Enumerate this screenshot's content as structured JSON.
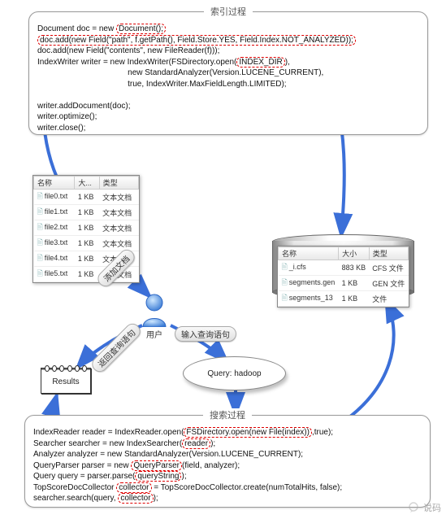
{
  "index_panel": {
    "title": "索引过程",
    "code_plain_1a": "Document doc = new ",
    "code_hl_1": "Document();",
    "code_plain_2a": "doc.add(new Field(\"path\", f.getPath(), Field.Store.YES, Field.Index.NOT_ANALYZED));",
    "code_plain_3": "doc.add(new Field(\"contents\", new FileReader(f)));",
    "code_plain_4a": "IndexWriter writer = new IndexWriter(FSDirectory.open(",
    "code_hl_4": "INDEX_DIR",
    "code_plain_4b": "),",
    "code_plain_5": "                                        new StandardAnalyzer(Version.LUCENE_CURRENT),",
    "code_plain_6": "                                        true, IndexWriter.MaxFieldLength.LIMITED);",
    "code_blank": "",
    "code_plain_7": "writer.addDocument(doc);",
    "code_plain_8": "writer.optimize();",
    "code_plain_9": "writer.close();"
  },
  "search_panel": {
    "title": "搜索过程",
    "l1a": "IndexReader reader = IndexReader.open(",
    "l1h": "FSDirectory.open(new File(index))",
    "l1b": ",true);",
    "l2a": "Searcher searcher = new IndexSearcher(",
    "l2h": "reader",
    "l2b": ");",
    "l3": "Analyzer analyzer = new StandardAnalyzer(Version.LUCENE_CURRENT);",
    "l4a": "QueryParser parser = new ",
    "l4h": "QueryParser",
    "l4b": "(field, analyzer);",
    "l5a": "Query query = parser.parse(",
    "l5h": "queryString",
    "l5b": ");",
    "l6a": "TopScoreDocCollector ",
    "l6h": "collector",
    "l6b": " = TopScoreDocCollector.create(numTotalHits, false);",
    "l7a": "searcher.search(query, ",
    "l7h": "collector",
    "l7b": ");"
  },
  "file_table": {
    "headers": [
      "名称",
      "大...",
      "类型"
    ],
    "rows": [
      [
        "file0.txt",
        "1 KB",
        "文本文档"
      ],
      [
        "file1.txt",
        "1 KB",
        "文本文档"
      ],
      [
        "file2.txt",
        "1 KB",
        "文本文档"
      ],
      [
        "file3.txt",
        "1 KB",
        "文本文档"
      ],
      [
        "file4.txt",
        "1 KB",
        "文本文档"
      ],
      [
        "file5.txt",
        "1 KB",
        "文本文档"
      ]
    ]
  },
  "index_dir_table": {
    "headers": [
      "名称",
      "大小",
      "类型"
    ],
    "rows": [
      [
        "_i.cfs",
        "883 KB",
        "CFS 文件"
      ],
      [
        "segments.gen",
        "1 KB",
        "GEN 文件"
      ],
      [
        "segments_13",
        "1 KB",
        "文件"
      ]
    ]
  },
  "user_label": "用户",
  "arrow_labels": {
    "add_doc": "添加文档",
    "return_query": "返回查询语句",
    "input_query": "输入查询语句"
  },
  "results_label": "Results",
  "query_label": "Query: hadoop",
  "watermark": "说码"
}
